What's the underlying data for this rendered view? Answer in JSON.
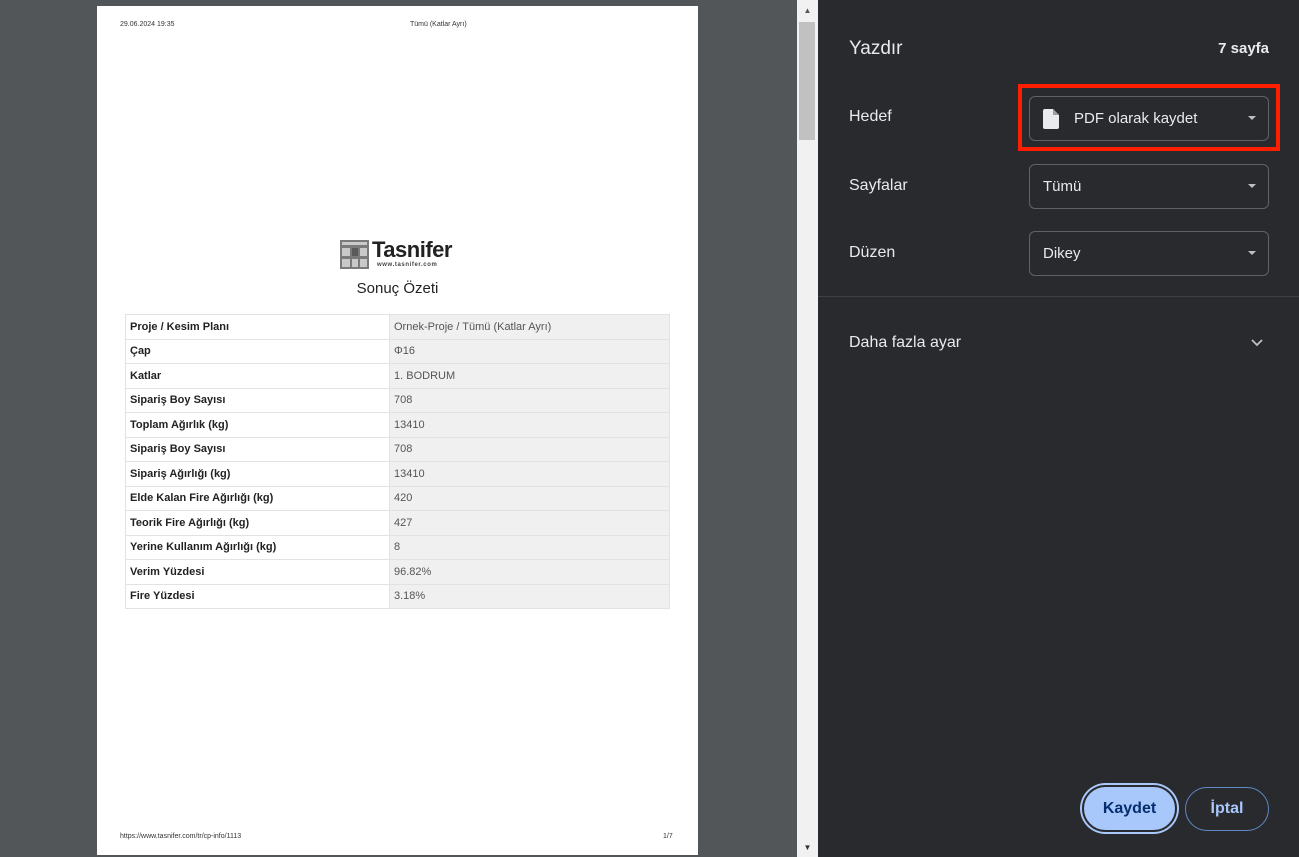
{
  "preview": {
    "header_date": "29.06.2024 19:35",
    "header_title": "Tümü (Katlar Ayrı)",
    "footer_url": "https://www.tasnifer.com/tr/cp-info/1113",
    "footer_page": "1/7",
    "logo_name": "Tasnifer",
    "logo_url": "www.tasnifer.com",
    "summary_title": "Sonuç Özeti",
    "rows": [
      {
        "label": "Proje / Kesim Planı",
        "value": "Ornek-Proje / Tümü (Katlar Ayrı)"
      },
      {
        "label": "Çap",
        "value": "Φ16"
      },
      {
        "label": "Katlar",
        "value": "1. BODRUM"
      },
      {
        "label": "Sipariş Boy Sayısı",
        "value": "708"
      },
      {
        "label": "Toplam Ağırlık (kg)",
        "value": "13410"
      },
      {
        "label": "Sipariş Boy Sayısı",
        "value": "708"
      },
      {
        "label": "Sipariş Ağırlığı (kg)",
        "value": "13410"
      },
      {
        "label": "Elde Kalan Fire Ağırlığı (kg)",
        "value": "420"
      },
      {
        "label": "Teorik Fire Ağırlığı (kg)",
        "value": "427"
      },
      {
        "label": "Yerine Kullanım Ağırlığı (kg)",
        "value": "8"
      },
      {
        "label": "Verim Yüzdesi",
        "value": "96.82%"
      },
      {
        "label": "Fire Yüzdesi",
        "value": "3.18%"
      }
    ]
  },
  "panel": {
    "title": "Yazdır",
    "page_count": "7 sayfa",
    "destination_label": "Hedef",
    "destination_value": "PDF olarak kaydet",
    "pages_label": "Sayfalar",
    "pages_value": "Tümü",
    "layout_label": "Düzen",
    "layout_value": "Dikey",
    "more_settings": "Daha fazla ayar",
    "save_label": "Kaydet",
    "cancel_label": "İptal"
  },
  "colors": {
    "panel_bg": "#292a2d",
    "preview_bg": "#525659",
    "accent": "#a8c7fa",
    "highlight": "#ff1f00"
  }
}
